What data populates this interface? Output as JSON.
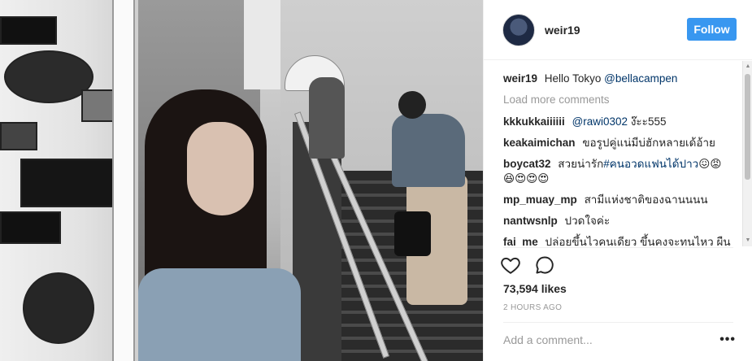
{
  "post": {
    "username": "weir19",
    "follow_label": "Follow",
    "colors": {
      "accent": "#3897f0",
      "mention": "#003569",
      "muted": "#999999"
    },
    "caption": {
      "user": "weir19",
      "text": "Hello Tokyo",
      "mention": "@bellacampen"
    },
    "load_more": "Load more comments",
    "comments": [
      {
        "user": "kkkukkaiiiiii",
        "mention": "@rawi0302",
        "text": "ง๊ะะ555"
      },
      {
        "user": "keakaimichan",
        "mention": "",
        "text": "ขอรูปคู่แน่มีบ่ฮักหลายเด้อ้าย"
      },
      {
        "user": "boycat32",
        "mention": "",
        "text": "สวยน่ารัก",
        "hashtag": "#คนอวดแฟนได้ปาว",
        "emoji": "😖😡😆😍😍😍"
      },
      {
        "user": "mp_muay_mp",
        "mention": "",
        "text": "สามีแห่งชาติของฉานนนน"
      },
      {
        "user": "nantwsnlp",
        "mention": "",
        "text": "ปวดใจค่ะ"
      },
      {
        "user": "fai_me",
        "mention": "",
        "text": "ปล่อยขึ้นไวคนเดียว ขึ้นคงจะทนไหว ผืน ได้ดาษใจ มีเรา ได้มีสขบาบ ใจขึ้นคงอาจจะริง"
      }
    ],
    "likes": "73,594 likes",
    "time": "2 HOURS AGO",
    "add_comment_placeholder": "Add a comment...",
    "more_label": "•••",
    "icons": {
      "like": "heart-icon",
      "comment": "comment-icon"
    }
  }
}
